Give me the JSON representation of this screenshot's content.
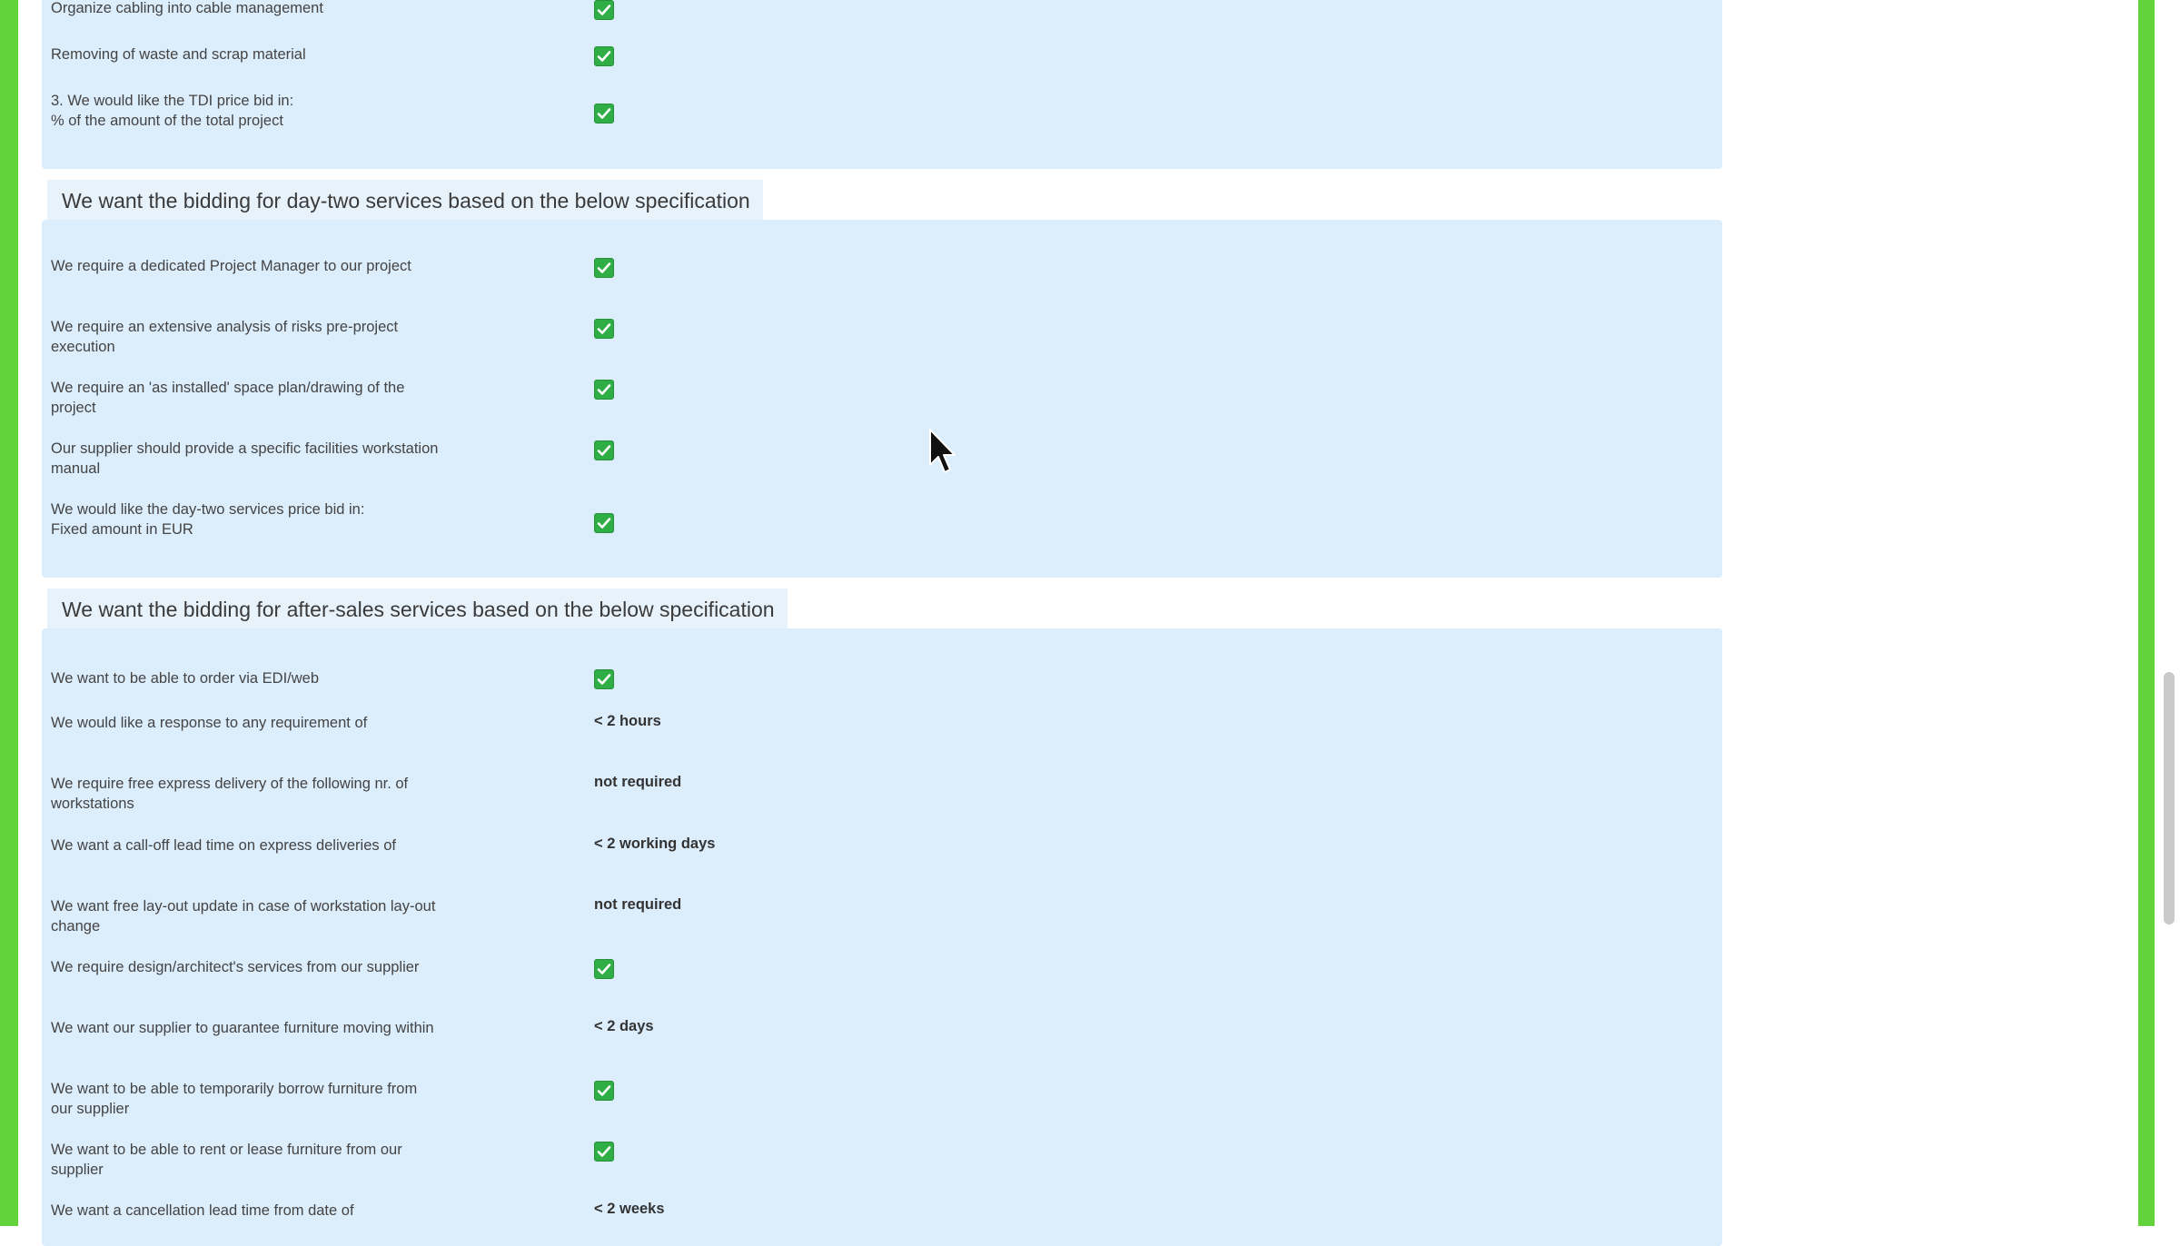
{
  "sections": {
    "top": {
      "rows": [
        {
          "label": "Organize cabling into cable management",
          "checked": true
        },
        {
          "label": "Removing of waste and scrap material",
          "checked": true
        },
        {
          "label": "3. We would like the TDI price bid in:\n% of the amount of the total project",
          "checked": true
        }
      ]
    },
    "day_two": {
      "title": "We want the bidding for day-two services based on the below specification",
      "rows": [
        {
          "label": "We require a dedicated Project Manager to our project",
          "checked": true
        },
        {
          "label": "We require an extensive analysis of risks pre-project execution",
          "checked": true
        },
        {
          "label": "We require an 'as installed' space plan/drawing of the project",
          "checked": true
        },
        {
          "label": "Our supplier should provide a specific facilities workstation manual",
          "checked": true
        },
        {
          "label": "We would like the day-two services price bid in:\nFixed amount in EUR",
          "checked": true
        }
      ]
    },
    "after_sales": {
      "title": "We want the bidding for after-sales services based on the below specification",
      "rows": [
        {
          "label": "We want to be able to order via EDI/web",
          "checked": true
        },
        {
          "label": "We would like a response to any requirement of",
          "value": "< 2 hours"
        },
        {
          "label": "We require free express delivery of the following nr. of workstations",
          "value": "not required"
        },
        {
          "label": "We want a call-off lead time on express deliveries of",
          "value": "< 2 working days"
        },
        {
          "label": "We want free lay-out update in case of workstation lay-out change",
          "value": "not required"
        },
        {
          "label": "We require design/architect's services from our supplier",
          "checked": true
        },
        {
          "label": "We want our supplier to guarantee furniture moving within",
          "value": "< 2 days"
        },
        {
          "label": "We want to be able to temporarily borrow furniture from our supplier",
          "checked": true
        },
        {
          "label": "We want to be able to rent or lease furniture from our supplier",
          "checked": true
        },
        {
          "label": "We want a cancellation lead time from date of",
          "value": "< 2 weeks"
        }
      ]
    }
  },
  "colors": {
    "frame": "#62d33a",
    "panel": "#dcedfc",
    "checkbox": "#2fae45"
  }
}
